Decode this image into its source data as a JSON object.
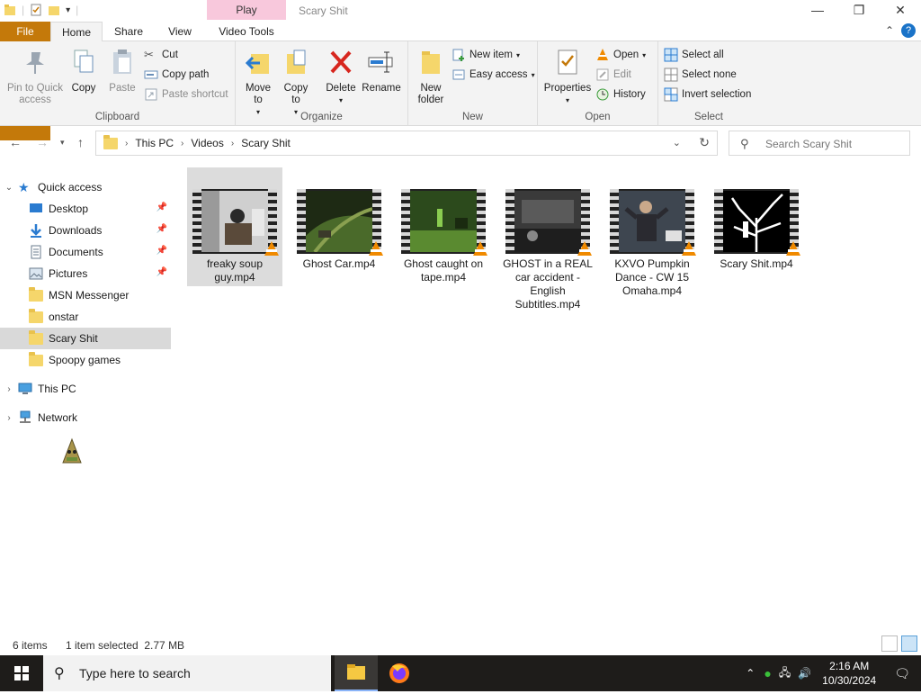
{
  "window": {
    "title": "Scary Shit",
    "context_tab": "Play",
    "controls": [
      "—",
      "❐",
      "✕"
    ]
  },
  "tabs": {
    "file": "File",
    "home": "Home",
    "share": "Share",
    "view": "View",
    "video_tools": "Video Tools"
  },
  "ribbon": {
    "clipboard": {
      "label": "Clipboard",
      "pin": "Pin to Quick access",
      "copy": "Copy",
      "paste": "Paste",
      "cut": "Cut",
      "copy_path": "Copy path",
      "paste_shortcut": "Paste shortcut"
    },
    "organize": {
      "label": "Organize",
      "move_to": "Move to",
      "copy_to": "Copy to",
      "delete": "Delete",
      "rename": "Rename"
    },
    "new": {
      "label": "New",
      "new_folder": "New folder",
      "new_item": "New item",
      "easy_access": "Easy access"
    },
    "open": {
      "label": "Open",
      "properties": "Properties",
      "open": "Open",
      "edit": "Edit",
      "history": "History"
    },
    "select": {
      "label": "Select",
      "select_all": "Select all",
      "select_none": "Select none",
      "invert": "Invert selection"
    }
  },
  "address": {
    "crumbs": [
      "This PC",
      "Videos",
      "Scary Shit"
    ],
    "search_placeholder": "Search Scary Shit"
  },
  "sidebar": {
    "quick_access": "Quick access",
    "items": [
      {
        "label": "Desktop",
        "pinned": true
      },
      {
        "label": "Downloads",
        "pinned": true
      },
      {
        "label": "Documents",
        "pinned": true
      },
      {
        "label": "Pictures",
        "pinned": true
      },
      {
        "label": "MSN Messenger",
        "pinned": false
      },
      {
        "label": "onstar",
        "pinned": false
      },
      {
        "label": "Scary Shit",
        "pinned": false
      },
      {
        "label": "Spoopy games",
        "pinned": false
      }
    ],
    "this_pc": "This PC",
    "network": "Network"
  },
  "files": [
    {
      "name": "freaky soup guy.mp4",
      "selected": true
    },
    {
      "name": "Ghost Car.mp4",
      "selected": false
    },
    {
      "name": "Ghost caught on tape.mp4",
      "selected": false
    },
    {
      "name": "GHOST in a REAL car accident - English Subtitles.mp4",
      "selected": false
    },
    {
      "name": "KXVO Pumpkin Dance - CW 15 Omaha.mp4",
      "selected": false
    },
    {
      "name": "Scary Shit.mp4",
      "selected": false
    }
  ],
  "status": {
    "items": "6 items",
    "selection": "1 item selected  2.77 MB"
  },
  "taskbar": {
    "search_placeholder": "Type here to search",
    "time": "2:16 AM",
    "date": "10/30/2024"
  },
  "colors": {
    "file_tab": "#c4790a",
    "context_tab": "#f8c8dc",
    "accent": "#1a73c8",
    "vlc_cone": "#f08a00"
  }
}
